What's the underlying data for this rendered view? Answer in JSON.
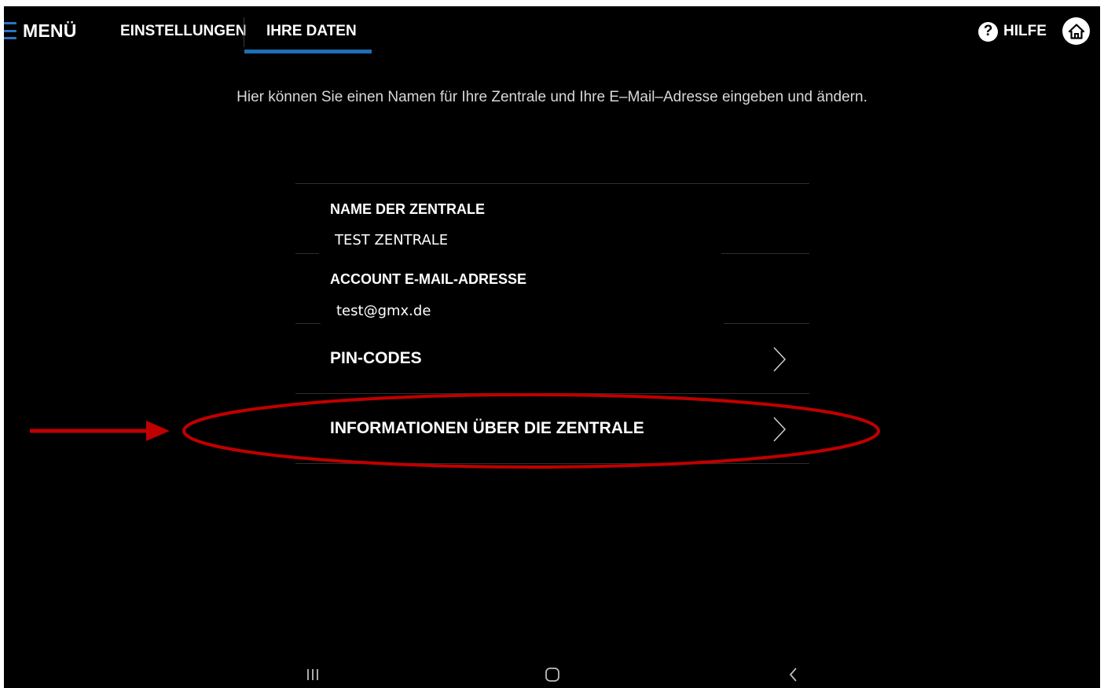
{
  "header": {
    "menu_label": "MENÜ",
    "tabs": [
      {
        "label": "EINSTELLUNGEN",
        "active": false
      },
      {
        "label": "IHRE DATEN",
        "active": true
      }
    ],
    "help_label": "HILFE",
    "help_glyph": "?"
  },
  "description": "Hier können Sie einen Namen für Ihre Zentrale und Ihre E–Mail–Adresse eingeben und ändern.",
  "form": {
    "name_label": "NAME DER ZENTRALE",
    "name_value": "TEST ZENTRALE",
    "email_label": "ACCOUNT E-MAIL-ADRESSE",
    "email_value": "test@gmx.de",
    "nav_items": [
      {
        "label": "PIN-CODES"
      },
      {
        "label": "INFORMATIONEN ÜBER DIE ZENTRALE",
        "highlighted": true
      }
    ]
  },
  "colors": {
    "background": "#000000",
    "accent": "#1f6fb5",
    "annotation": "#c00000",
    "text": "#ffffff"
  },
  "icons": {
    "menu": "hamburger-icon",
    "help": "question-circle-icon",
    "home": "home-icon",
    "chevron": "chevron-right-icon",
    "recents": "recent-apps-icon",
    "home_nav": "home-nav-icon",
    "back": "back-icon"
  }
}
